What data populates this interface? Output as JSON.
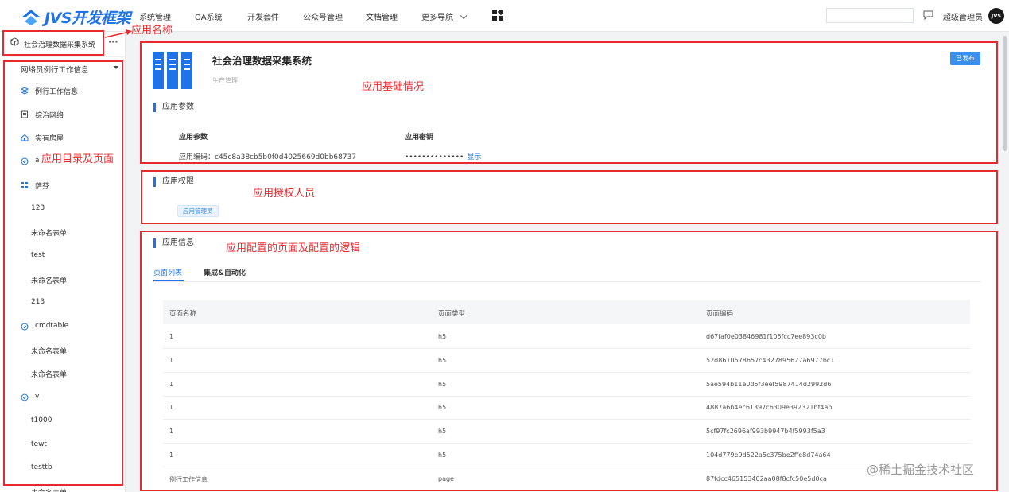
{
  "brand": {
    "logo_text": "JVS开发框架"
  },
  "topnav": {
    "items": [
      "系统管理",
      "OA系统",
      "开发套件",
      "公众号管理",
      "文档管理",
      "更多导航"
    ],
    "user": "超级管理员",
    "avatar": "JVS"
  },
  "sidebar": {
    "app_name": "社会治理数据采集系统",
    "more": "···",
    "dir_title": "网络员例行工作信息",
    "items": [
      {
        "label": "例行工作信息",
        "icon": "layers-icon"
      },
      {
        "label": "综治网络",
        "icon": "document-icon"
      },
      {
        "label": "实有房屋",
        "icon": "house-icon"
      },
      {
        "label": "a",
        "icon": "check-circle-icon"
      },
      {
        "label": "萨芬",
        "icon": "grid-icon"
      },
      {
        "label": "123",
        "icon": ""
      },
      {
        "label": "未命名表单",
        "icon": ""
      },
      {
        "label": "test",
        "icon": ""
      },
      {
        "label": "未命名表单",
        "icon": ""
      },
      {
        "label": "213",
        "icon": ""
      },
      {
        "label": "cmdtable",
        "icon": "check-circle-icon"
      },
      {
        "label": "未命名表单",
        "icon": ""
      },
      {
        "label": "未命名表单",
        "icon": ""
      },
      {
        "label": "v",
        "icon": "check-circle-icon"
      },
      {
        "label": "t1000",
        "icon": ""
      },
      {
        "label": "tewt",
        "icon": ""
      },
      {
        "label": "testtb",
        "icon": ""
      },
      {
        "label": "未命名表单",
        "icon": ""
      }
    ]
  },
  "app_info": {
    "title": "社会治理数据采集系统",
    "subtitle": "生产管理",
    "status_button": "已发布",
    "params_section": "应用参数",
    "param_header": "应用参数",
    "secret_header": "应用密钥",
    "code_value": "应用编码：c45c8a38cb5b0f0d4025669d0bb68737",
    "secret_value": "••••••••••••••",
    "show_link": "显示"
  },
  "permissions": {
    "section": "应用权限",
    "role": "应用管理员"
  },
  "pages": {
    "section": "应用信息",
    "tabs": [
      "页面列表",
      "集成&自动化"
    ],
    "columns": [
      "页面名称",
      "页面类型",
      "页面编码"
    ],
    "rows": [
      [
        "1",
        "h5",
        "d67faf0e03846981f105fcc7ee893c0b"
      ],
      [
        "1",
        "h5",
        "52d8610578657c4327895627a6977bc1"
      ],
      [
        "1",
        "h5",
        "5ae594b11e0d5f3eef5987414d2992d6"
      ],
      [
        "1",
        "h5",
        "4887a6b4ec61397c6309e392321bf4ab"
      ],
      [
        "1",
        "h5",
        "5cf97fc2696af993b9947b4f5993f5a3"
      ],
      [
        "1",
        "h5",
        "104d779e9d522a5c375be2ffe8d74a64"
      ],
      [
        "例行工作信息",
        "page",
        "87fdcc465153402aa08f8cfc50e5d0ca"
      ]
    ]
  },
  "annotations": {
    "app_name": "应用名称",
    "app_basic": "应用基础情况",
    "directory": "应用目录及页面",
    "auth": "应用授权人员",
    "config": "应用配置的页面及配置的逻辑"
  },
  "watermark": "@稀土掘金技术社区",
  "colors": {
    "accent": "#1e73e8",
    "annotation": "#e8292e",
    "publish": "#3b8ff0"
  }
}
